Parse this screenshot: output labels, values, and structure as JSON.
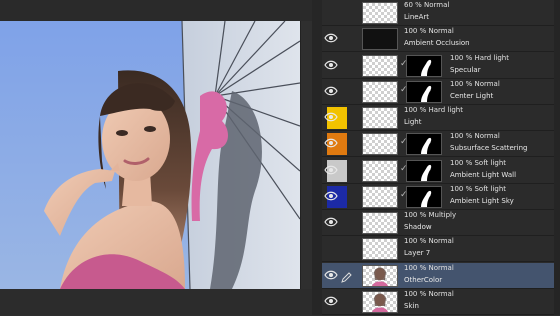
{
  "colors": {
    "sky": "#84a8e6",
    "wall": "#d4dbe6",
    "ribbon": "#d86aa6",
    "selected_row": "#44546e",
    "swatch_yellow": "#f2c200",
    "swatch_orange": "#e07a10",
    "swatch_gray": "#c9c9c9",
    "swatch_blue": "#1c2aa6"
  },
  "layers": [
    {
      "blend": "60 % Normal",
      "name": "LineArt",
      "visible": false,
      "swatch": null,
      "thumb": "transparent",
      "mask": false,
      "selected": false
    },
    {
      "blend": "100 % Normal",
      "name": "Ambient Occlusion",
      "visible": true,
      "swatch": null,
      "thumb": "dark",
      "mask": false,
      "selected": false
    },
    {
      "blend": "100 % Hard light",
      "name": "Specular",
      "visible": true,
      "swatch": null,
      "thumb": "transparent",
      "mask": true,
      "selected": false
    },
    {
      "blend": "100 % Normal",
      "name": "Center Light",
      "visible": true,
      "swatch": null,
      "thumb": "transparent",
      "mask": true,
      "selected": false
    },
    {
      "blend": "100 % Hard light",
      "name": "Light",
      "visible": true,
      "swatch": "swatch_yellow",
      "thumb": "transparent",
      "mask": false,
      "selected": false
    },
    {
      "blend": "100 % Normal",
      "name": "Subsurface Scattering",
      "visible": true,
      "swatch": "swatch_orange",
      "thumb": "transparent",
      "mask": true,
      "selected": false
    },
    {
      "blend": "100 % Soft light",
      "name": "Ambient Light Wall",
      "visible": true,
      "swatch": "swatch_gray",
      "thumb": "transparent",
      "mask": true,
      "selected": false
    },
    {
      "blend": "100 % Soft light",
      "name": "Ambient Light Sky",
      "visible": true,
      "swatch": "swatch_blue",
      "thumb": "transparent",
      "mask": true,
      "selected": false
    },
    {
      "blend": "100 % Multiply",
      "name": "Shadow",
      "visible": true,
      "swatch": null,
      "thumb": "transparent",
      "mask": false,
      "selected": false
    },
    {
      "blend": "100 % Normal",
      "name": "Layer 7",
      "visible": false,
      "swatch": null,
      "thumb": "transparent",
      "mask": false,
      "selected": false
    },
    {
      "blend": "100 % Normal",
      "name": "OtherColor",
      "visible": true,
      "swatch": null,
      "thumb": "portrait",
      "mask": false,
      "selected": true
    },
    {
      "blend": "100 % Normal",
      "name": "Skin",
      "visible": true,
      "swatch": null,
      "thumb": "portrait",
      "mask": false,
      "selected": false
    }
  ]
}
